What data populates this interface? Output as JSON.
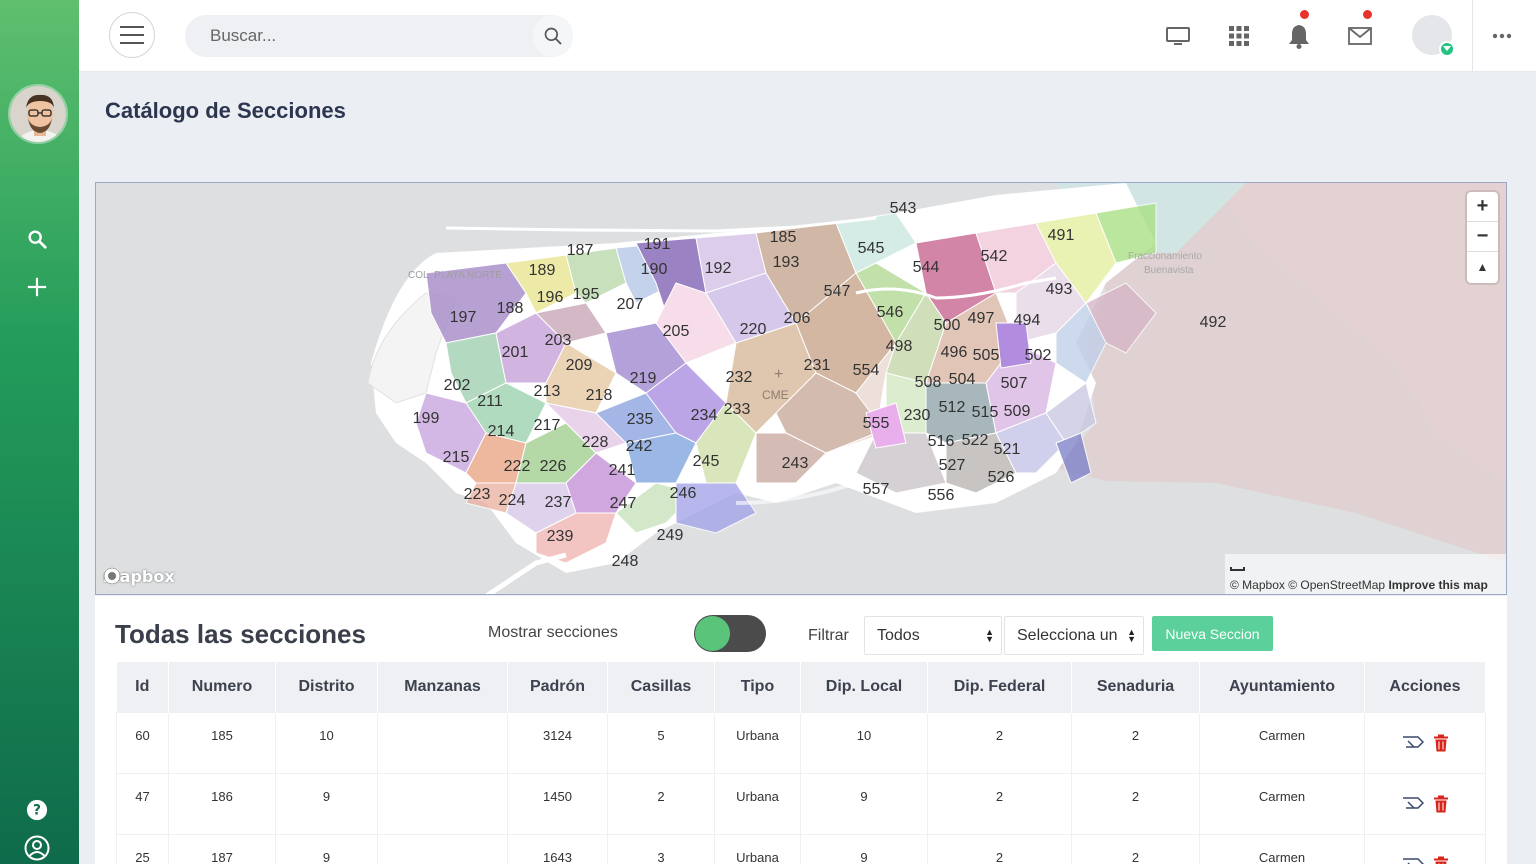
{
  "topbar": {
    "search_placeholder": "Buscar..."
  },
  "page": {
    "title": "Catálogo de Secciones"
  },
  "map": {
    "labels": [
      "543",
      "491",
      "185",
      "191",
      "187",
      "545",
      "193",
      "542",
      "192",
      "189",
      "190",
      "544",
      "195",
      "196",
      "207",
      "493",
      "547",
      "197",
      "188",
      "220",
      "546",
      "205",
      "206",
      "497",
      "494",
      "492",
      "500",
      "203",
      "201",
      "498",
      "496",
      "505",
      "502",
      "209",
      "231",
      "554",
      "219",
      "232",
      "504",
      "508",
      "507",
      "202",
      "213",
      "218",
      "211",
      "233",
      "199",
      "234",
      "512",
      "515",
      "509",
      "235",
      "230",
      "214",
      "217",
      "555",
      "228",
      "522",
      "242",
      "516",
      "215",
      "521",
      "245",
      "243",
      "527",
      "226",
      "222",
      "526",
      "241",
      "223",
      "224",
      "246",
      "557",
      "556",
      "237",
      "247",
      "249",
      "239",
      "248"
    ],
    "place_playa": "COL. PLAYA NORTE",
    "place_fracc1": "Fraccionamiento",
    "place_fracc2": "Buenavista",
    "place_cme": "CME",
    "logo": "mapbox",
    "attribution": "© Mapbox © OpenStreetMap",
    "improve": "Improve this map",
    "zoom_in": "+",
    "zoom_out": "−",
    "compass": "▲"
  },
  "sections": {
    "title": "Todas las secciones",
    "toggle_label": "Mostrar secciones",
    "filter_label": "Filtrar",
    "filter_value": "Todos",
    "select_value": "Selecciona un",
    "new_button": "Nueva Seccion",
    "columns": [
      "Id",
      "Numero",
      "Distrito",
      "Manzanas",
      "Padrón",
      "Casillas",
      "Tipo",
      "Dip. Local",
      "Dip. Federal",
      "Senaduria",
      "Ayuntamiento",
      "Acciones"
    ],
    "rows": [
      {
        "id": "60",
        "numero": "185",
        "distrito": "10",
        "manzanas": "",
        "padron": "3124",
        "casillas": "5",
        "tipo": "Urbana",
        "dip_local": "10",
        "dip_federal": "2",
        "senaduria": "2",
        "ayuntamiento": "Carmen"
      },
      {
        "id": "47",
        "numero": "186",
        "distrito": "9",
        "manzanas": "",
        "padron": "1450",
        "casillas": "2",
        "tipo": "Urbana",
        "dip_local": "9",
        "dip_federal": "2",
        "senaduria": "2",
        "ayuntamiento": "Carmen"
      },
      {
        "id": "25",
        "numero": "187",
        "distrito": "9",
        "manzanas": "",
        "padron": "1643",
        "casillas": "3",
        "tipo": "Urbana",
        "dip_local": "9",
        "dip_federal": "2",
        "senaduria": "2",
        "ayuntamiento": "Carmen"
      }
    ]
  },
  "colors": {
    "sidebar_top": "#5fbf6e",
    "sidebar_bottom": "#0f6b4b",
    "accent_button": "#5bd09a",
    "notification_dot": "#e8322b",
    "delete_icon": "#d9261c"
  }
}
